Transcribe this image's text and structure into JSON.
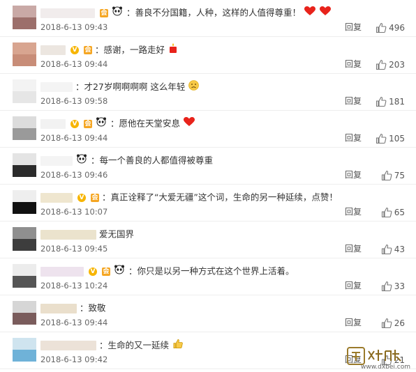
{
  "comments": [
    {
      "text": "：善良不分国籍，人种，这样的人值得尊重！",
      "time": "2018-6-13 09:43",
      "reply": "回复",
      "likes": "496"
    },
    {
      "text": "：感谢，一路走好",
      "time": "2018-6-13 09:44",
      "reply": "回复",
      "likes": "203"
    },
    {
      "text": "：才27岁啊啊啊啊 这么年轻",
      "time": "2018-6-13 09:58",
      "reply": "回复",
      "likes": "181"
    },
    {
      "text": "：愿他在天堂安息",
      "time": "2018-6-13 09:44",
      "reply": "回复",
      "likes": "105"
    },
    {
      "text": "：每一个善良的人都值得被尊重",
      "time": "2018-6-13 09:46",
      "reply": "回复",
      "likes": "75"
    },
    {
      "text": "：真正诠释了“大爱无疆”这个词，生命的另一种延续，点赞！",
      "time": "2018-6-13 10:07",
      "reply": "回复",
      "likes": "65"
    },
    {
      "text": "爱无国界",
      "time": "2018-6-13 09:45",
      "reply": "回复",
      "likes": "43"
    },
    {
      "text": "：你只是以另一种方式在这个世界上活着。",
      "time": "2018-6-13 10:24",
      "reply": "回复",
      "likes": "33"
    },
    {
      "text": "：致敬",
      "time": "2018-6-13 09:44",
      "reply": "回复",
      "likes": "26"
    },
    {
      "text": "：生命的又一延续",
      "time": "2018-6-13 09:42",
      "reply": "回复",
      "likes": "21"
    }
  ],
  "watermark": {
    "url": "www.dxbei.com"
  },
  "colors": {
    "text": "#333333",
    "muted": "#666666",
    "divider": "#eeeeee",
    "heart": "#e8231b",
    "badge": "#f5a623"
  }
}
